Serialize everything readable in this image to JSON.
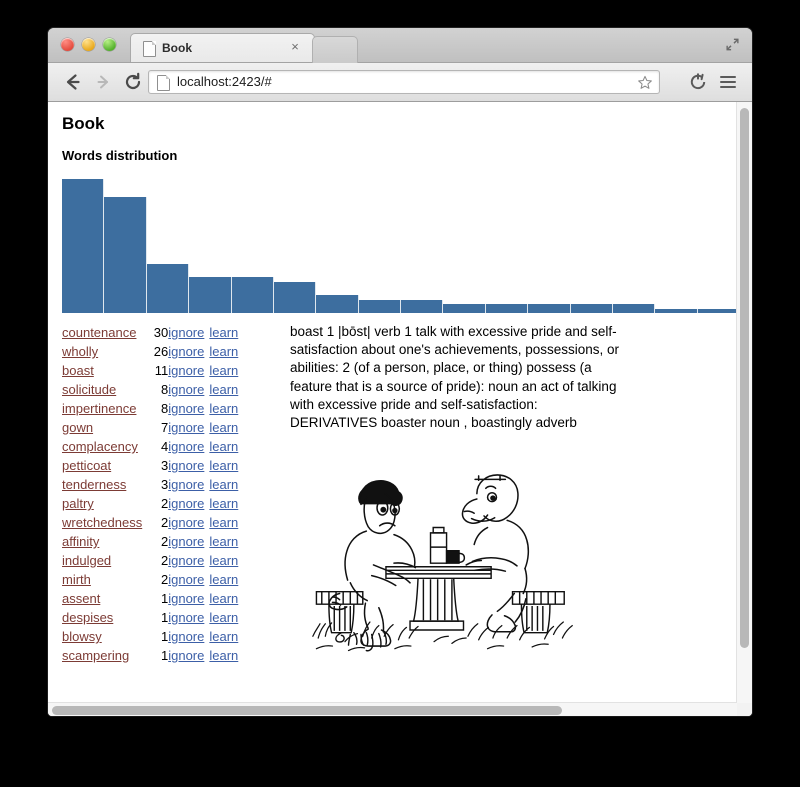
{
  "browser": {
    "tab": {
      "title": "Book",
      "favicon": "document-icon",
      "close": "×"
    },
    "toolbar": {
      "back": "back-icon",
      "forward": "forward-icon",
      "reload": "reload-icon",
      "url": "localhost:2423/#",
      "star": "star-icon",
      "sync": "sync-icon",
      "menu": "menu-icon"
    },
    "fullscreen": "fullscreen-icon"
  },
  "page": {
    "title": "Book",
    "section_title": "Words distribution",
    "definition": "boast 1 |bōst| verb 1 talk with excessive pride and self-satisfaction about one's achievements, possessions, or abilities: 2 (of a person, place, or thing) possess (a feature that is a source of pride): noun an act of talking with excessive pride and self-satisfaction: DERIVATIVES boaster noun , boastingly adverb",
    "actions": {
      "ignore": "ignore",
      "learn": "learn"
    },
    "words": [
      {
        "word": "countenance",
        "count": "30"
      },
      {
        "word": "wholly",
        "count": "26"
      },
      {
        "word": "boast",
        "count": "11"
      },
      {
        "word": "solicitude",
        "count": "8"
      },
      {
        "word": "impertinence",
        "count": "8"
      },
      {
        "word": "gown",
        "count": "7"
      },
      {
        "word": "complacency",
        "count": "4"
      },
      {
        "word": "petticoat",
        "count": "3"
      },
      {
        "word": "tenderness",
        "count": "3"
      },
      {
        "word": "paltry",
        "count": "2"
      },
      {
        "word": "wretchedness",
        "count": "2"
      },
      {
        "word": "affinity",
        "count": "2"
      },
      {
        "word": "indulged",
        "count": "2"
      },
      {
        "word": "mirth",
        "count": "2"
      },
      {
        "word": "assent",
        "count": "1"
      },
      {
        "word": "despises",
        "count": "1"
      },
      {
        "word": "blowsy",
        "count": "1"
      },
      {
        "word": "scampering",
        "count": "1"
      }
    ],
    "illustration": "arm-wrestling-cartoon"
  },
  "chart_data": {
    "type": "bar",
    "title": "Words distribution",
    "xlabel": "",
    "ylabel": "",
    "grid": false,
    "legend": null,
    "bar_color": "#3d6e9f",
    "categories": [
      "countenance",
      "wholly",
      "boast",
      "solicitude",
      "impertinence",
      "gown",
      "complacency",
      "petticoat",
      "tenderness",
      "paltry",
      "wretchedness",
      "affinity",
      "indulged",
      "mirth",
      "assent",
      "despises"
    ],
    "values": [
      30,
      26,
      11,
      8,
      8,
      7,
      4,
      3,
      3,
      2,
      2,
      2,
      2,
      2,
      1,
      1
    ],
    "ylim": [
      0,
      30
    ]
  }
}
